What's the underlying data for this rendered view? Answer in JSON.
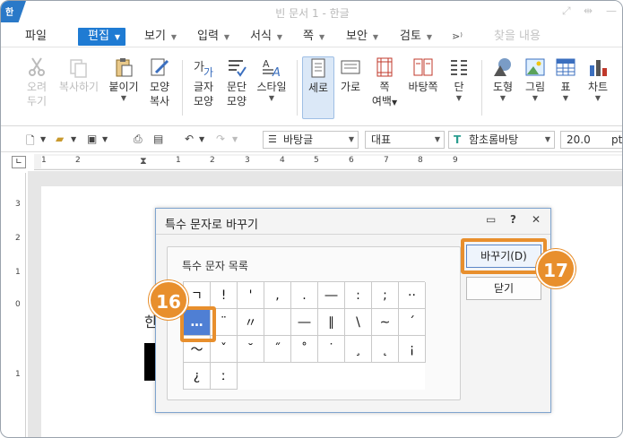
{
  "window": {
    "logo": "한",
    "title": "빈 문서 1 - 한글"
  },
  "menu": {
    "items": [
      {
        "label": "파일",
        "caret": false
      },
      {
        "label": "편집",
        "caret": true,
        "active": true
      },
      {
        "label": "보기",
        "caret": true
      },
      {
        "label": "입력",
        "caret": true
      },
      {
        "label": "서식",
        "caret": true
      },
      {
        "label": "쪽",
        "caret": true
      },
      {
        "label": "보안",
        "caret": true
      },
      {
        "label": "검토",
        "caret": true
      }
    ],
    "search_text": "찾을 내용"
  },
  "ribbon": {
    "cut_line1": "오려",
    "cut_line2": "두기",
    "copy": "복사하기",
    "paste": "붙이기",
    "format_copy_line1": "모양",
    "format_copy_line2": "복사",
    "char_shape_line1": "글자",
    "char_shape_line2": "모양",
    "para_shape_line1": "문단",
    "para_shape_line2": "모양",
    "style": "스타일",
    "vertical": "세로",
    "horizontal": "가로",
    "page_margin_line1": "쪽",
    "page_margin_line2": "여백",
    "background_page": "바탕쪽",
    "column": "단",
    "shape": "도형",
    "picture": "그림",
    "table": "표",
    "chart": "차트"
  },
  "toolbar": {
    "style_combo": "바탕글",
    "lang_combo": "대표",
    "font_combo": "함초롬바탕",
    "size_combo": "20.0",
    "unit": "pt"
  },
  "ruler": {
    "h_numbers": [
      "1",
      "2",
      "1",
      "2",
      "3",
      "4",
      "5",
      "6",
      "7",
      "8",
      "9"
    ],
    "v_numbers": [
      "3",
      "2",
      "1",
      "0",
      "1"
    ]
  },
  "document": {
    "visible_char": "한"
  },
  "dialog": {
    "title": "특수 문자로 바꾸기",
    "list_label": "특수 문자 목록",
    "replace_button": "바꾸기(D)",
    "close_button": "닫기",
    "symbols": [
      [
        "ㄱ",
        "!",
        "'",
        ",",
        ".",
        "―",
        ":",
        ";",
        "··"
      ],
      [
        "…",
        "¨",
        "〃",
        "",
        "―",
        "∥",
        "\\",
        "∼",
        "´"
      ],
      [
        "～",
        "ˇ",
        "˘",
        "˝",
        "˚",
        "˙",
        "¸",
        "˛",
        "¡"
      ],
      [
        "¿",
        "ː",
        "",
        "",
        "",
        "",
        "",
        "",
        ""
      ]
    ],
    "selected": "…"
  },
  "annotations": {
    "step_select": "16",
    "step_replace": "17"
  },
  "colors": {
    "accent": "#1f7bd3",
    "highlight": "#e88f2d",
    "selected_cell": "#4f7fd4"
  }
}
